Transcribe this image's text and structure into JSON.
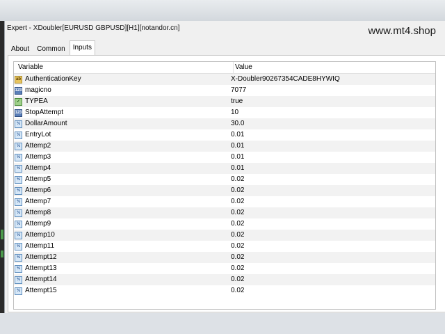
{
  "window": {
    "title": "Expert - XDoubler[EURUSD GBPUSD][H1][notandor.cn]",
    "watermark": "www.mt4.shop"
  },
  "tabs": [
    {
      "label": "About",
      "active": false
    },
    {
      "label": "Common",
      "active": false
    },
    {
      "label": "Inputs",
      "active": true
    }
  ],
  "grid": {
    "columns": [
      "Variable",
      "Value"
    ],
    "rows": [
      {
        "icon": "string-icon",
        "glyph": "ab",
        "variable": "AuthenticationKey",
        "value": "X-Doubler90267354CADE8HYWIQ"
      },
      {
        "icon": "integer-icon",
        "glyph": "123",
        "variable": "magicno",
        "value": "7077"
      },
      {
        "icon": "boolean-icon",
        "glyph": "✓",
        "variable": "TYPEA",
        "value": "true"
      },
      {
        "icon": "integer-icon",
        "glyph": "123",
        "variable": "StopAttempt",
        "value": "10"
      },
      {
        "icon": "double-icon",
        "glyph": "½",
        "variable": "DollarAmount",
        "value": "30.0"
      },
      {
        "icon": "double-icon",
        "glyph": "½",
        "variable": "EntryLot",
        "value": "0.01"
      },
      {
        "icon": "double-icon",
        "glyph": "½",
        "variable": "Attemp2",
        "value": "0.01"
      },
      {
        "icon": "double-icon",
        "glyph": "½",
        "variable": "Attemp3",
        "value": "0.01"
      },
      {
        "icon": "double-icon",
        "glyph": "½",
        "variable": "Attemp4",
        "value": "0.01"
      },
      {
        "icon": "double-icon",
        "glyph": "½",
        "variable": "Attemp5",
        "value": "0.02"
      },
      {
        "icon": "double-icon",
        "glyph": "½",
        "variable": "Attemp6",
        "value": "0.02"
      },
      {
        "icon": "double-icon",
        "glyph": "½",
        "variable": "Attemp7",
        "value": "0.02"
      },
      {
        "icon": "double-icon",
        "glyph": "½",
        "variable": "Attemp8",
        "value": "0.02"
      },
      {
        "icon": "double-icon",
        "glyph": "½",
        "variable": "Attemp9",
        "value": "0.02"
      },
      {
        "icon": "double-icon",
        "glyph": "½",
        "variable": "Attemp10",
        "value": "0.02"
      },
      {
        "icon": "double-icon",
        "glyph": "½",
        "variable": "Attemp11",
        "value": "0.02"
      },
      {
        "icon": "double-icon",
        "glyph": "½",
        "variable": "Attempt12",
        "value": "0.02"
      },
      {
        "icon": "double-icon",
        "glyph": "½",
        "variable": "Attempt13",
        "value": "0.02"
      },
      {
        "icon": "double-icon",
        "glyph": "½",
        "variable": "Attempt14",
        "value": "0.02"
      },
      {
        "icon": "double-icon",
        "glyph": "½",
        "variable": "Attempt15",
        "value": "0.02"
      }
    ]
  }
}
